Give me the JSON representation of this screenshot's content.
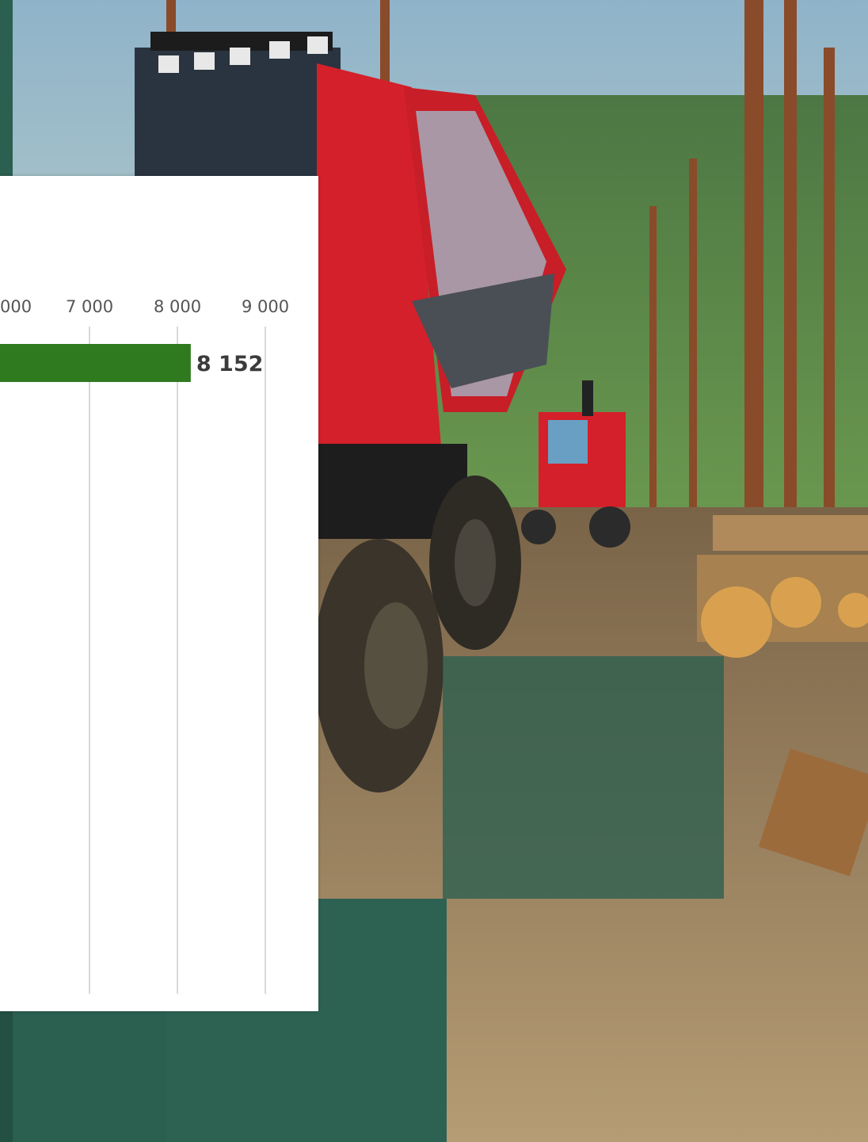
{
  "colors": {
    "accent_green": "#2f7a1f",
    "panel_teal": "#2b5f50",
    "card_background": "#ffffff",
    "machine_red": "#d4202a"
  },
  "scene": {
    "description_icons": [
      "forest-photo",
      "forwarder-machine",
      "log-pile",
      "teal-overlay-panel"
    ]
  },
  "chart_data": {
    "type": "bar",
    "orientation": "horizontal",
    "x_ticks": [
      "000",
      "7 000",
      "8 000",
      "9 000"
    ],
    "x_tick_values": [
      6000,
      7000,
      8000,
      9000
    ],
    "xlim": [
      6000,
      9300
    ],
    "grid": true,
    "series": [
      {
        "values": [
          8152
        ],
        "labels": [
          "8 152"
        ],
        "color": "#2f7a1f"
      }
    ]
  }
}
